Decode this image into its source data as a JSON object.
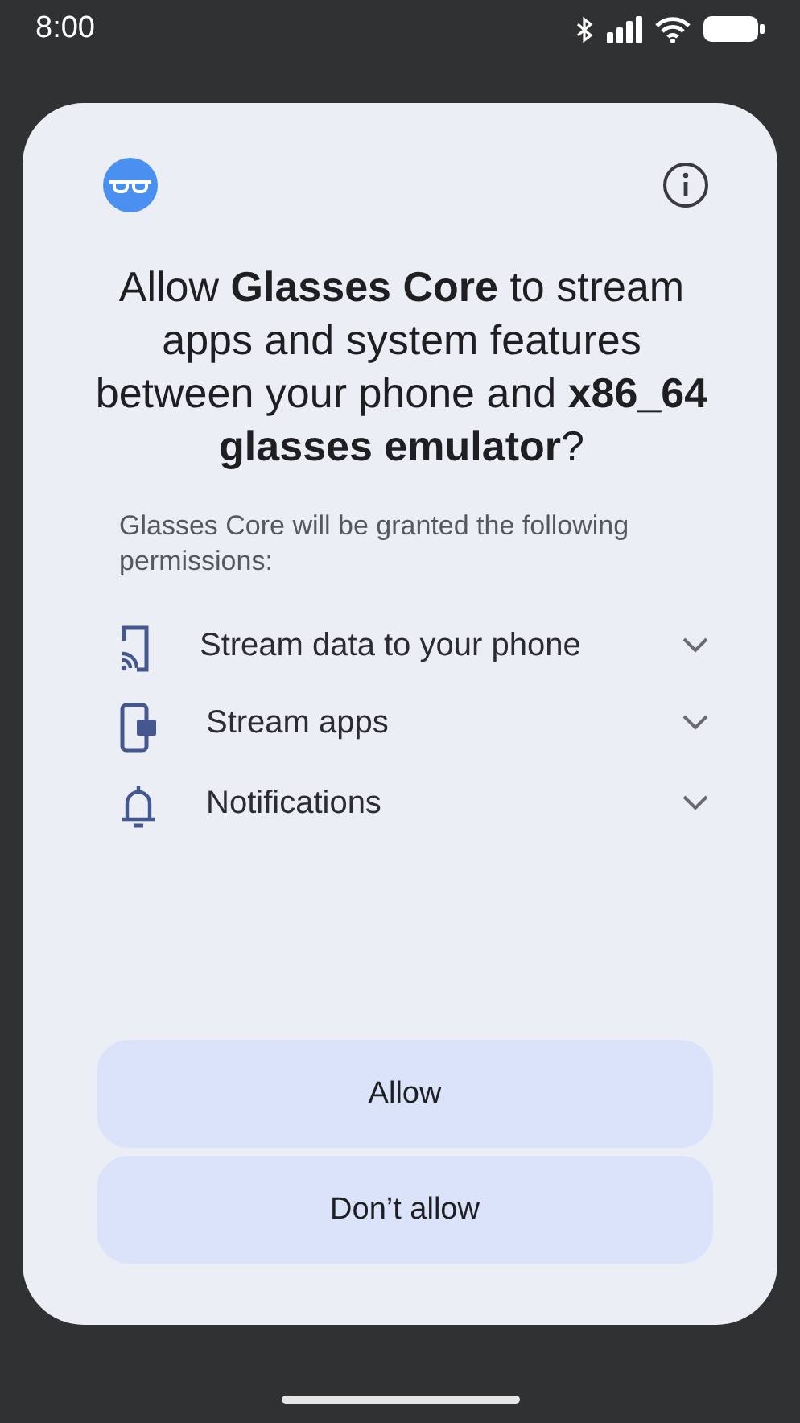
{
  "status_bar": {
    "time": "8:00"
  },
  "dialog": {
    "title": "Allow **Glasses Core** to stream apps and system features between your phone and **x86_64 glasses emulator**?",
    "subtitle": "Glasses Core will be granted the following permissions:",
    "permissions": [
      {
        "kind": "cast",
        "label": "Stream data to your phone",
        "expanded": false
      },
      {
        "kind": "apps",
        "label": "Stream apps",
        "expanded": false
      },
      {
        "kind": "bell",
        "label": "Notifications",
        "expanded": false
      }
    ],
    "buttons": [
      "Allow",
      "Don’t allow"
    ]
  }
}
